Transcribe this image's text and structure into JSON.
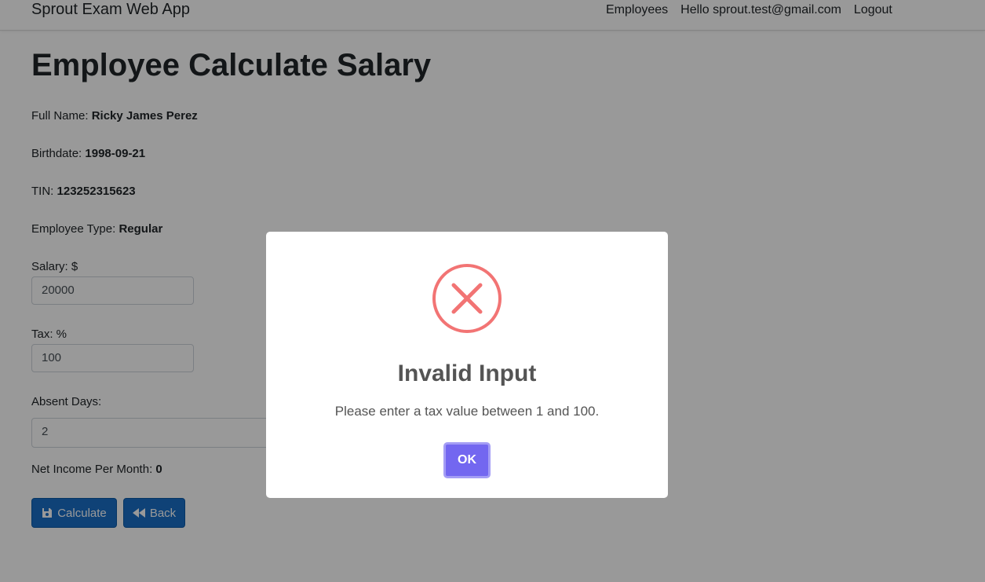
{
  "navbar": {
    "brand": "Sprout Exam Web App",
    "links": [
      "Employees",
      "Hello sprout.test@gmail.com",
      "Logout"
    ]
  },
  "page": {
    "title": "Employee Calculate Salary",
    "full_name_label": "Full Name:",
    "full_name": "Ricky James Perez",
    "birthdate_label": "Birthdate:",
    "birthdate": "1998-09-21",
    "tin_label": "TIN:",
    "tin": "123252315623",
    "employee_type_label": "Employee Type:",
    "employee_type": "Regular",
    "salary_label": "Salary: $",
    "salary_value": "20000",
    "tax_label": "Tax: %",
    "tax_value": "100",
    "absent_days_label": "Absent Days:",
    "absent_days_value": "2",
    "net_income_label": "Net Income Per Month:",
    "net_income": "0",
    "calculate_label": "Calculate",
    "back_label": "Back"
  },
  "modal": {
    "title": "Invalid Input",
    "message": "Please enter a tax value between 1 and 100.",
    "ok_label": "OK",
    "icon": "error-x-icon"
  },
  "colors": {
    "primary_button": "#1a6fc7",
    "modal_confirm": "#7367f0",
    "error_icon": "#f27474",
    "overlay": "rgba(0,0,0,0.40)"
  }
}
